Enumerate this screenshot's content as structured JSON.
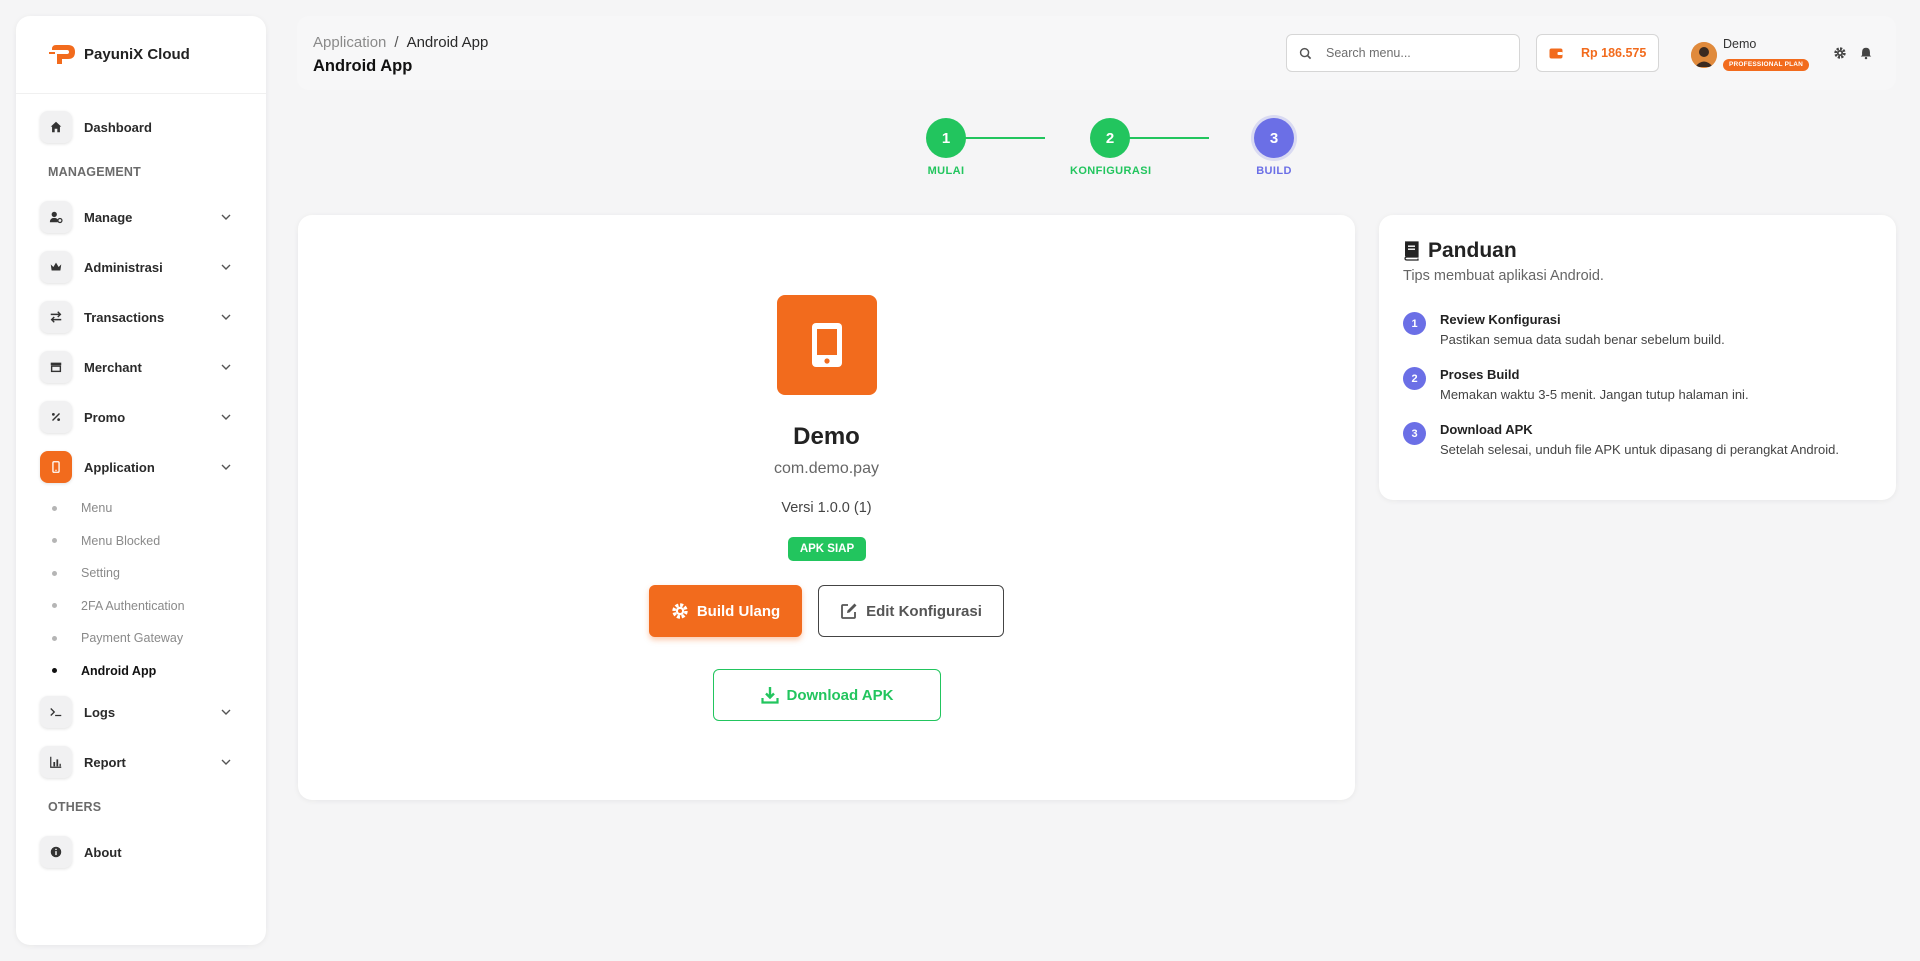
{
  "brand": {
    "name": "PayuniX Cloud"
  },
  "sidebar": {
    "dashboard": "Dashboard",
    "section_management": "MANAGEMENT",
    "items": [
      {
        "label": "Manage",
        "icon": "user-gear-icon"
      },
      {
        "label": "Administrasi",
        "icon": "crown-icon"
      },
      {
        "label": "Transactions",
        "icon": "arrows-exchange-icon"
      },
      {
        "label": "Merchant",
        "icon": "store-icon"
      },
      {
        "label": "Promo",
        "icon": "percent-icon"
      },
      {
        "label": "Application",
        "icon": "mobile-icon"
      }
    ],
    "application_sub": [
      {
        "label": "Menu"
      },
      {
        "label": "Menu Blocked"
      },
      {
        "label": "Setting"
      },
      {
        "label": "2FA Authentication"
      },
      {
        "label": "Payment Gateway"
      },
      {
        "label": "Android App"
      }
    ],
    "logs": "Logs",
    "report": "Report",
    "section_others": "OTHERS",
    "about": "About"
  },
  "header": {
    "breadcrumb_parent": "Application",
    "breadcrumb_sep": "/",
    "breadcrumb_current": "Android App",
    "title": "Android App",
    "search_placeholder": "Search menu...",
    "balance": "Rp 186.575",
    "user_name": "Demo",
    "plan": "PROFESSIONAL PLAN"
  },
  "stepper": {
    "steps": [
      {
        "num": "1",
        "label": "MULAI",
        "state": "done"
      },
      {
        "num": "2",
        "label": "KONFIGURASI",
        "state": "done"
      },
      {
        "num": "3",
        "label": "BUILD",
        "state": "active"
      }
    ]
  },
  "app": {
    "name": "Demo",
    "package": "com.demo.pay",
    "version": "Versi 1.0.0 (1)",
    "status": "APK SIAP",
    "build_button": "Build Ulang",
    "edit_button": "Edit Konfigurasi",
    "download_button": "Download APK"
  },
  "guide": {
    "title": "Panduan",
    "subtitle": "Tips membuat aplikasi Android.",
    "tips": [
      {
        "num": "1",
        "title": "Review Konfigurasi",
        "desc": "Pastikan semua data sudah benar sebelum build."
      },
      {
        "num": "2",
        "title": "Proses Build",
        "desc": "Memakan waktu 3-5 menit. Jangan tutup halaman ini."
      },
      {
        "num": "3",
        "title": "Download APK",
        "desc": "Setelah selesai, unduh file APK untuk dipasang di perangkat Android."
      }
    ]
  },
  "colors": {
    "accent": "#f26b1d",
    "success": "#22c55e",
    "step_active": "#6b6fe6"
  }
}
